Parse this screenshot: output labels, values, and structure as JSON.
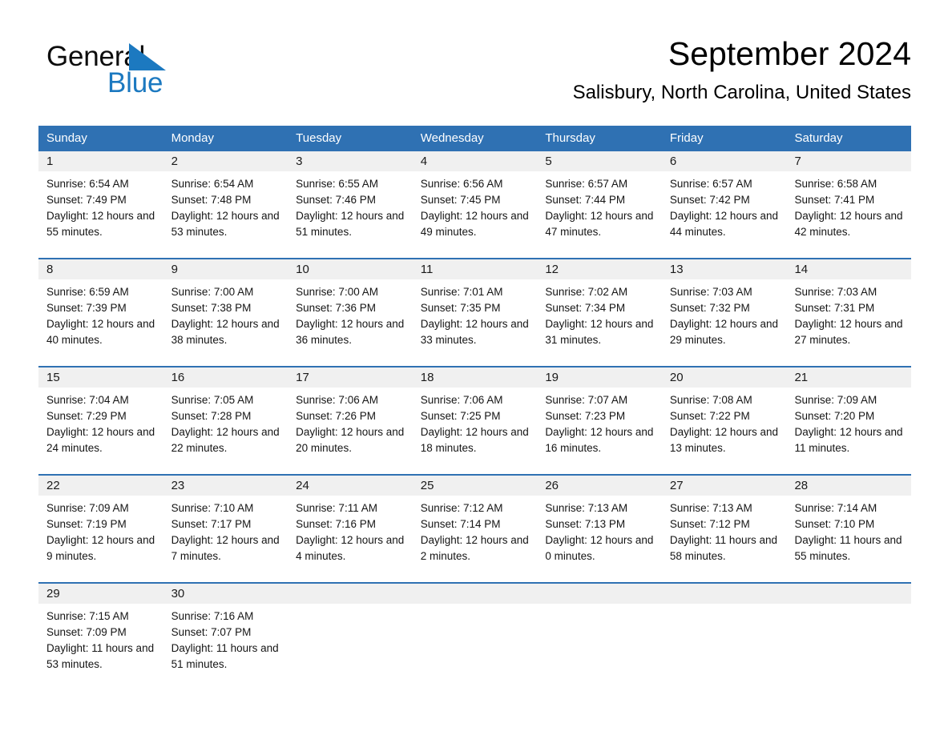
{
  "brand": {
    "name_part1": "General",
    "name_part2": "Blue",
    "triangle_color": "#1c79c0",
    "text_color": "#0d0d0d"
  },
  "header": {
    "title": "September 2024",
    "location": "Salisbury, North Carolina, United States"
  },
  "theme": {
    "header_blue": "#2f71b3",
    "daynum_band": "#f0f0f0",
    "page_background": "#ffffff",
    "text": "#000000"
  },
  "calendar": {
    "weekday_headers": [
      "Sunday",
      "Monday",
      "Tuesday",
      "Wednesday",
      "Thursday",
      "Friday",
      "Saturday"
    ],
    "weeks": [
      [
        {
          "day": "1",
          "sunrise": "Sunrise: 6:54 AM",
          "sunset": "Sunset: 7:49 PM",
          "daylight": "Daylight: 12 hours and 55 minutes."
        },
        {
          "day": "2",
          "sunrise": "Sunrise: 6:54 AM",
          "sunset": "Sunset: 7:48 PM",
          "daylight": "Daylight: 12 hours and 53 minutes."
        },
        {
          "day": "3",
          "sunrise": "Sunrise: 6:55 AM",
          "sunset": "Sunset: 7:46 PM",
          "daylight": "Daylight: 12 hours and 51 minutes."
        },
        {
          "day": "4",
          "sunrise": "Sunrise: 6:56 AM",
          "sunset": "Sunset: 7:45 PM",
          "daylight": "Daylight: 12 hours and 49 minutes."
        },
        {
          "day": "5",
          "sunrise": "Sunrise: 6:57 AM",
          "sunset": "Sunset: 7:44 PM",
          "daylight": "Daylight: 12 hours and 47 minutes."
        },
        {
          "day": "6",
          "sunrise": "Sunrise: 6:57 AM",
          "sunset": "Sunset: 7:42 PM",
          "daylight": "Daylight: 12 hours and 44 minutes."
        },
        {
          "day": "7",
          "sunrise": "Sunrise: 6:58 AM",
          "sunset": "Sunset: 7:41 PM",
          "daylight": "Daylight: 12 hours and 42 minutes."
        }
      ],
      [
        {
          "day": "8",
          "sunrise": "Sunrise: 6:59 AM",
          "sunset": "Sunset: 7:39 PM",
          "daylight": "Daylight: 12 hours and 40 minutes."
        },
        {
          "day": "9",
          "sunrise": "Sunrise: 7:00 AM",
          "sunset": "Sunset: 7:38 PM",
          "daylight": "Daylight: 12 hours and 38 minutes."
        },
        {
          "day": "10",
          "sunrise": "Sunrise: 7:00 AM",
          "sunset": "Sunset: 7:36 PM",
          "daylight": "Daylight: 12 hours and 36 minutes."
        },
        {
          "day": "11",
          "sunrise": "Sunrise: 7:01 AM",
          "sunset": "Sunset: 7:35 PM",
          "daylight": "Daylight: 12 hours and 33 minutes."
        },
        {
          "day": "12",
          "sunrise": "Sunrise: 7:02 AM",
          "sunset": "Sunset: 7:34 PM",
          "daylight": "Daylight: 12 hours and 31 minutes."
        },
        {
          "day": "13",
          "sunrise": "Sunrise: 7:03 AM",
          "sunset": "Sunset: 7:32 PM",
          "daylight": "Daylight: 12 hours and 29 minutes."
        },
        {
          "day": "14",
          "sunrise": "Sunrise: 7:03 AM",
          "sunset": "Sunset: 7:31 PM",
          "daylight": "Daylight: 12 hours and 27 minutes."
        }
      ],
      [
        {
          "day": "15",
          "sunrise": "Sunrise: 7:04 AM",
          "sunset": "Sunset: 7:29 PM",
          "daylight": "Daylight: 12 hours and 24 minutes."
        },
        {
          "day": "16",
          "sunrise": "Sunrise: 7:05 AM",
          "sunset": "Sunset: 7:28 PM",
          "daylight": "Daylight: 12 hours and 22 minutes."
        },
        {
          "day": "17",
          "sunrise": "Sunrise: 7:06 AM",
          "sunset": "Sunset: 7:26 PM",
          "daylight": "Daylight: 12 hours and 20 minutes."
        },
        {
          "day": "18",
          "sunrise": "Sunrise: 7:06 AM",
          "sunset": "Sunset: 7:25 PM",
          "daylight": "Daylight: 12 hours and 18 minutes."
        },
        {
          "day": "19",
          "sunrise": "Sunrise: 7:07 AM",
          "sunset": "Sunset: 7:23 PM",
          "daylight": "Daylight: 12 hours and 16 minutes."
        },
        {
          "day": "20",
          "sunrise": "Sunrise: 7:08 AM",
          "sunset": "Sunset: 7:22 PM",
          "daylight": "Daylight: 12 hours and 13 minutes."
        },
        {
          "day": "21",
          "sunrise": "Sunrise: 7:09 AM",
          "sunset": "Sunset: 7:20 PM",
          "daylight": "Daylight: 12 hours and 11 minutes."
        }
      ],
      [
        {
          "day": "22",
          "sunrise": "Sunrise: 7:09 AM",
          "sunset": "Sunset: 7:19 PM",
          "daylight": "Daylight: 12 hours and 9 minutes."
        },
        {
          "day": "23",
          "sunrise": "Sunrise: 7:10 AM",
          "sunset": "Sunset: 7:17 PM",
          "daylight": "Daylight: 12 hours and 7 minutes."
        },
        {
          "day": "24",
          "sunrise": "Sunrise: 7:11 AM",
          "sunset": "Sunset: 7:16 PM",
          "daylight": "Daylight: 12 hours and 4 minutes."
        },
        {
          "day": "25",
          "sunrise": "Sunrise: 7:12 AM",
          "sunset": "Sunset: 7:14 PM",
          "daylight": "Daylight: 12 hours and 2 minutes."
        },
        {
          "day": "26",
          "sunrise": "Sunrise: 7:13 AM",
          "sunset": "Sunset: 7:13 PM",
          "daylight": "Daylight: 12 hours and 0 minutes."
        },
        {
          "day": "27",
          "sunrise": "Sunrise: 7:13 AM",
          "sunset": "Sunset: 7:12 PM",
          "daylight": "Daylight: 11 hours and 58 minutes."
        },
        {
          "day": "28",
          "sunrise": "Sunrise: 7:14 AM",
          "sunset": "Sunset: 7:10 PM",
          "daylight": "Daylight: 11 hours and 55 minutes."
        }
      ],
      [
        {
          "day": "29",
          "sunrise": "Sunrise: 7:15 AM",
          "sunset": "Sunset: 7:09 PM",
          "daylight": "Daylight: 11 hours and 53 minutes."
        },
        {
          "day": "30",
          "sunrise": "Sunrise: 7:16 AM",
          "sunset": "Sunset: 7:07 PM",
          "daylight": "Daylight: 11 hours and 51 minutes."
        },
        {
          "day": "",
          "sunrise": "",
          "sunset": "",
          "daylight": ""
        },
        {
          "day": "",
          "sunrise": "",
          "sunset": "",
          "daylight": ""
        },
        {
          "day": "",
          "sunrise": "",
          "sunset": "",
          "daylight": ""
        },
        {
          "day": "",
          "sunrise": "",
          "sunset": "",
          "daylight": ""
        },
        {
          "day": "",
          "sunrise": "",
          "sunset": "",
          "daylight": ""
        }
      ]
    ]
  }
}
